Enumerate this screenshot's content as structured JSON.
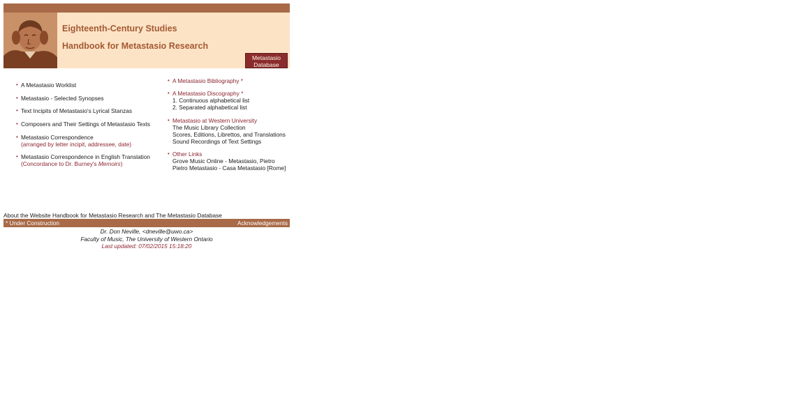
{
  "header": {
    "title_line1": "Eighteenth-Century Studies",
    "title_line2": "Handbook for Metastasio Research",
    "database_button": "Metastasio Database",
    "database_button_line1": "Metastasio",
    "database_button_line2": "Database",
    "portrait": "portrait-of-metastasio"
  },
  "left_column": {
    "items": [
      {
        "label": "A Metastasio Worklist"
      },
      {
        "label": "Metastasio - Selected Synopses"
      },
      {
        "label": "Text Incipits of Metastasio's Lyrical Stanzas"
      },
      {
        "label": "Composers and Their Settings of Metastasio Texts"
      },
      {
        "label": "Metastasio Correspondence",
        "sub": "(arranged by letter incipit, addressee, date)"
      },
      {
        "label": "Metastasio Correspondence in English Translation",
        "sub_prefix": "(Concordance to Dr. Burney's ",
        "sub_em": "Memoirs",
        "sub_suffix": ")"
      }
    ]
  },
  "right_column": {
    "bibliography": "A Metastasio Bibliography *",
    "discography": {
      "label": "A Metastasio Discography *",
      "sub": [
        "1. Continuous alphabetical list",
        "2. Separated alphabetical list"
      ]
    },
    "western": {
      "label": "Metastasio at Western University",
      "sub": [
        "The Music Library Collection",
        "Scores, Editions, Librettos, and Translations",
        "Sound Recordings of Text Settings"
      ]
    },
    "other": {
      "label": "Other Links",
      "sub": [
        "Grove Music Online - Metastasio, Pietro",
        "Pietro Metastasio - Casa Metastasio [Rome]"
      ]
    }
  },
  "footer": {
    "about": "About the Website Handbook for Metastasio Research and The Metastasio Database",
    "under_construction": "*  Under Construction",
    "acknowledgements": "Acknowledgements",
    "author": "Dr. Don Neville, <dneville@uwo.ca>",
    "faculty": "Faculty of Music, The University of Western Ontario",
    "last_updated": "Last updated: 07/02/2015 15:18:20"
  },
  "colors": {
    "bar": "#a86a48",
    "banner_bg": "#fde3c6",
    "title": "#a35a33",
    "link_red": "#8b2530",
    "button": "#8b2c2c"
  }
}
